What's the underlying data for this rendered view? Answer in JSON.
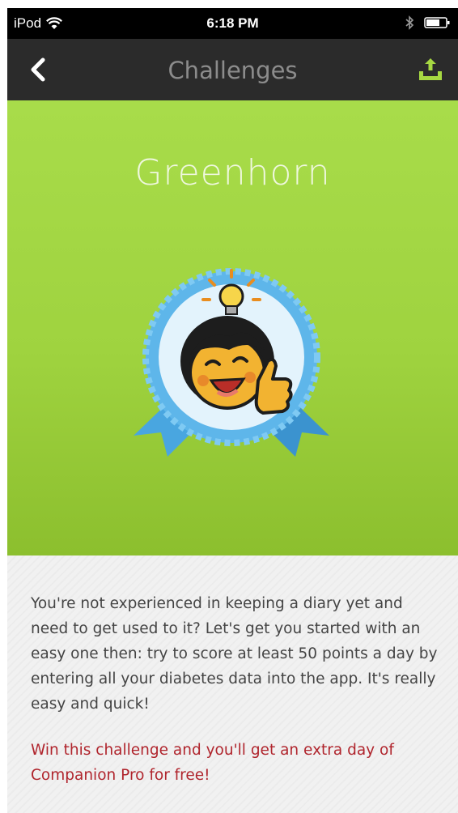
{
  "status_bar": {
    "device": "iPod",
    "time": "6:18 PM",
    "wifi_icon": "wifi-icon",
    "bluetooth_icon": "bluetooth-icon",
    "battery_icon": "battery-icon"
  },
  "nav": {
    "title": "Challenges",
    "back_icon": "chevron-left-icon",
    "sync_icon": "upload-tray-icon",
    "accent_color": "#a6d842"
  },
  "hero": {
    "title": "Greenhorn",
    "badge_icon": "greenhorn-badge-icon",
    "background_color": "#9fd33f"
  },
  "content": {
    "description": "You're not experienced in keeping a diary yet and need to get used to it? Let's get you started with an easy one then: try to score at least 50 points a day by entering all your diabetes data into the app. It's really easy and quick!",
    "reward": "Win this challenge and you'll get an extra day of Companion Pro for free!",
    "reward_color": "#b0252d"
  }
}
